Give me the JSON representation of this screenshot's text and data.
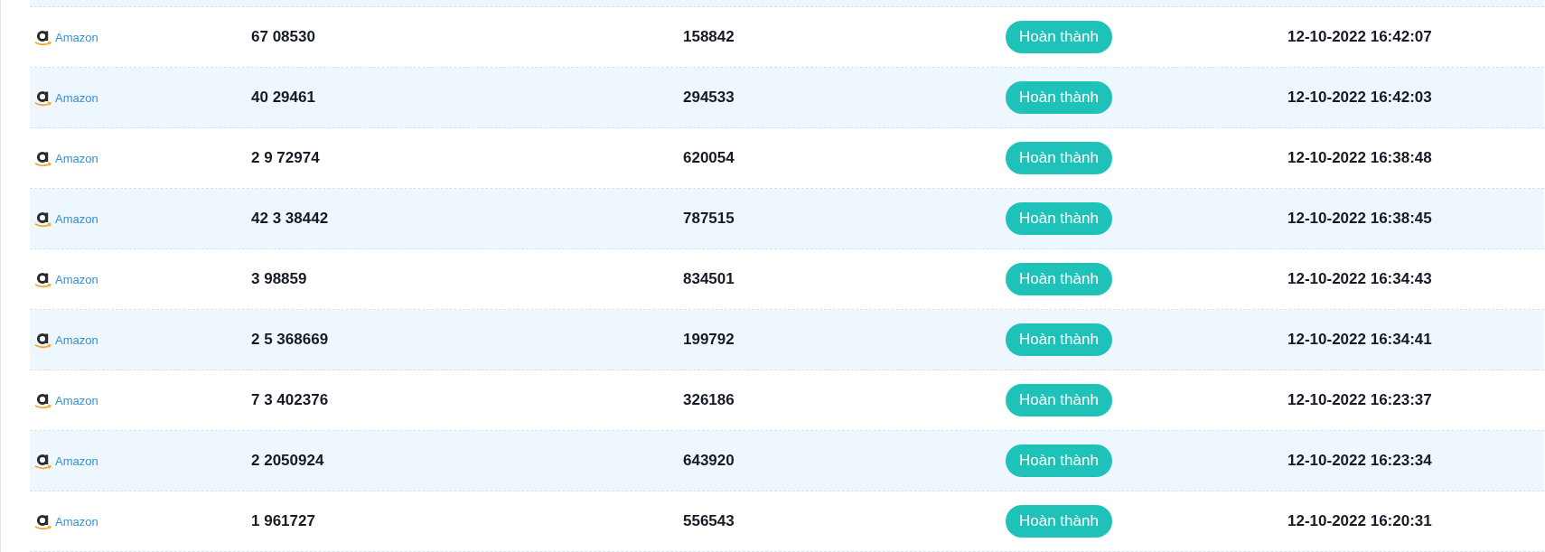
{
  "rows": [
    {
      "store": "Amazon",
      "account": "67 08530",
      "code": "158842",
      "status": "Hoàn thành",
      "time": "12-10-2022 16:42:07"
    },
    {
      "store": "Amazon",
      "account": "40 29461",
      "code": "294533",
      "status": "Hoàn thành",
      "time": "12-10-2022 16:42:03"
    },
    {
      "store": "Amazon",
      "account": "2 9 72974",
      "code": "620054",
      "status": "Hoàn thành",
      "time": "12-10-2022 16:38:48"
    },
    {
      "store": "Amazon",
      "account": "42 3 38442",
      "code": "787515",
      "status": "Hoàn thành",
      "time": "12-10-2022 16:38:45"
    },
    {
      "store": "Amazon",
      "account": "3 98859",
      "code": "834501",
      "status": "Hoàn thành",
      "time": "12-10-2022 16:34:43"
    },
    {
      "store": "Amazon",
      "account": "2 5 368669",
      "code": "199792",
      "status": "Hoàn thành",
      "time": "12-10-2022 16:34:41"
    },
    {
      "store": "Amazon",
      "account": "7 3 402376",
      "code": "326186",
      "status": "Hoàn thành",
      "time": "12-10-2022 16:23:37"
    },
    {
      "store": "Amazon",
      "account": "2 2050924",
      "code": "643920",
      "status": "Hoàn thành",
      "time": "12-10-2022 16:23:34"
    },
    {
      "store": "Amazon",
      "account": "1 961727",
      "code": "556543",
      "status": "Hoàn thành",
      "time": "12-10-2022 16:20:31"
    }
  ]
}
